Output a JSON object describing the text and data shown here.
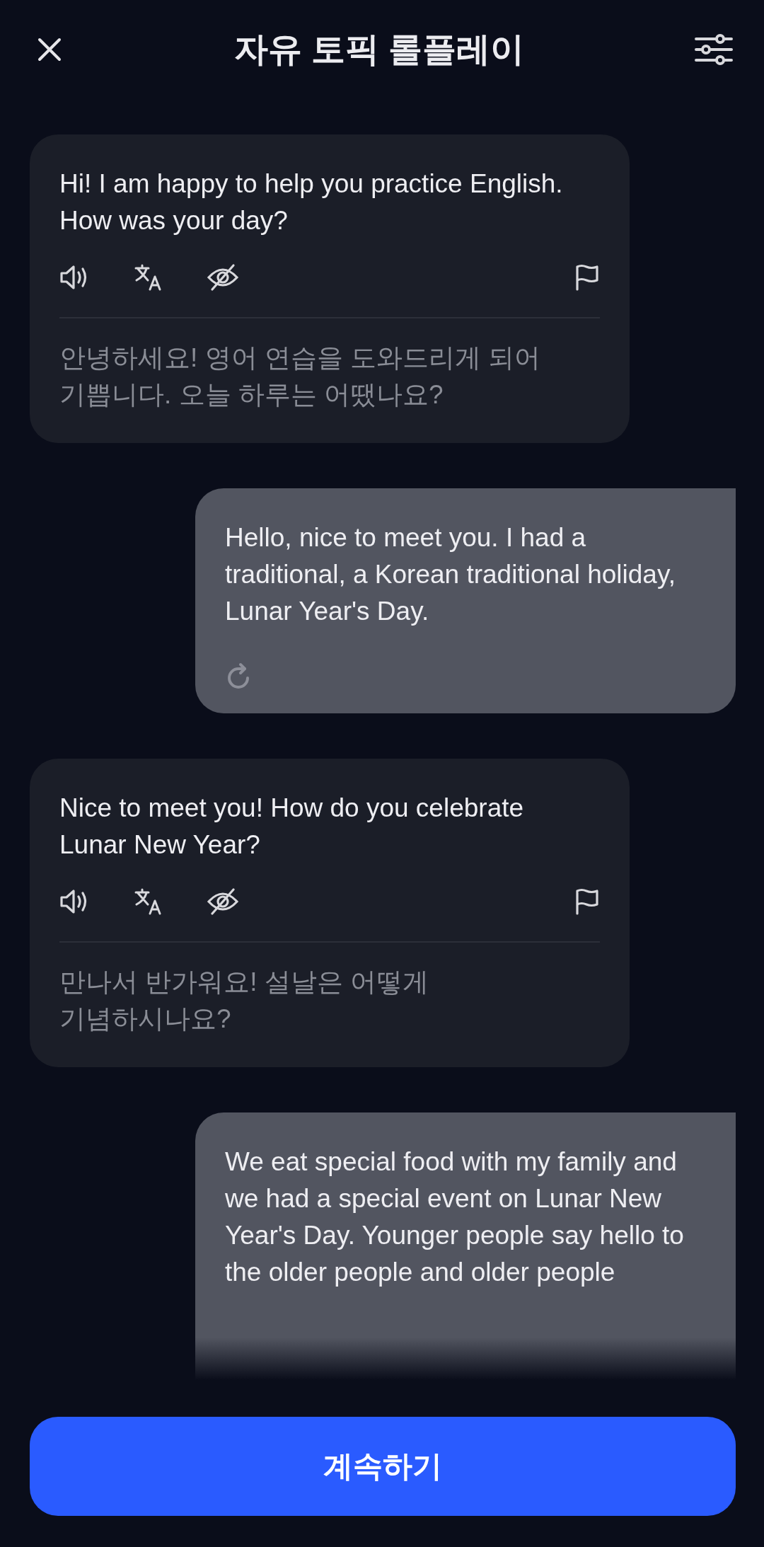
{
  "header": {
    "title": "자유 토픽 롤플레이"
  },
  "messages": [
    {
      "kind": "bot",
      "text": "Hi! I am happy to help you practice English. How was your day?",
      "translation": "안녕하세요! 영어 연습을 도와드리게 되어 기쁩니다. 오늘 하루는 어땠나요?"
    },
    {
      "kind": "user",
      "text": "Hello, nice to meet you. I had a traditional, a Korean traditional holiday, Lunar Year's Day.",
      "cut": false
    },
    {
      "kind": "bot",
      "text": "Nice to meet you! How do you celebrate Lunar New Year?",
      "translation": "만나서 반가워요! 설날은 어떻게 기념하시나요?"
    },
    {
      "kind": "user",
      "text": "We eat special food with my family and we had a special event on Lunar New Year's Day. Younger people say hello to the older people and older people",
      "cut": true
    }
  ],
  "continue_button": {
    "label": "계속하기"
  }
}
